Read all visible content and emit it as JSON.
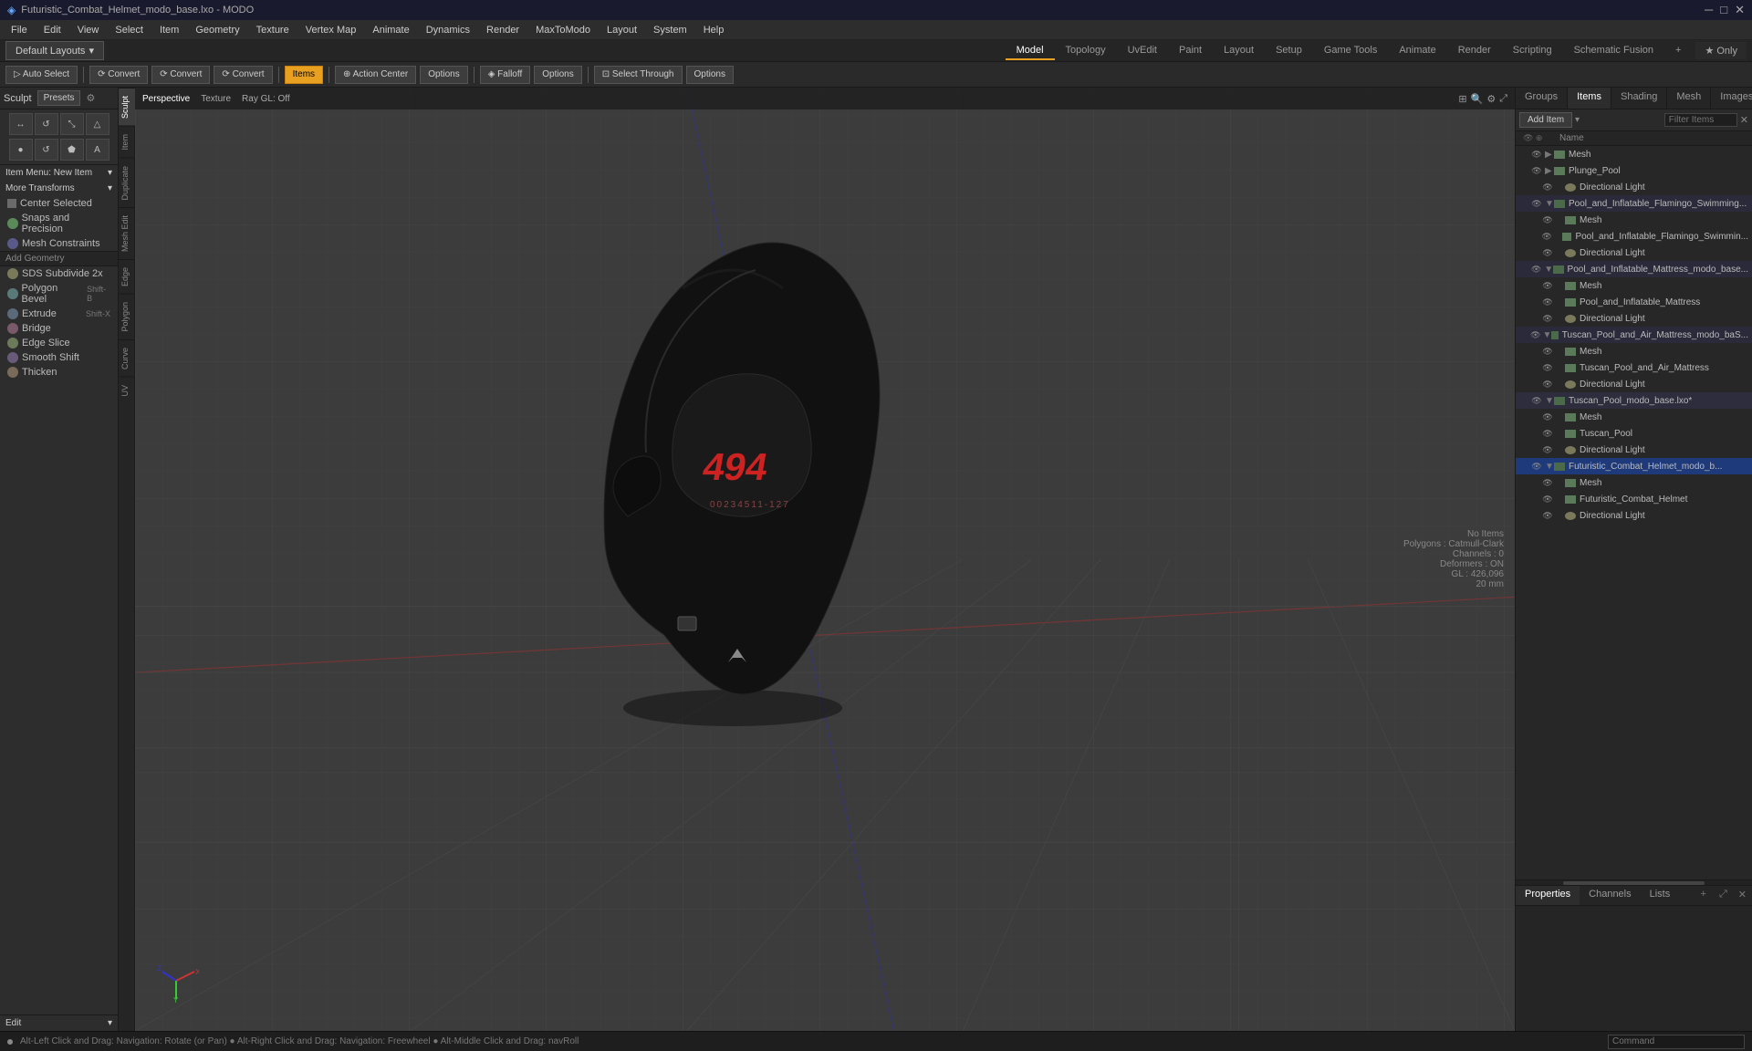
{
  "titlebar": {
    "title": "Futuristic_Combat_Helmet_modo_base.lxo - MODO",
    "controls": [
      "─",
      "□",
      "✕"
    ]
  },
  "menubar": {
    "items": [
      "File",
      "Edit",
      "View",
      "Select",
      "Item",
      "Geometry",
      "Texture",
      "Vertex Map",
      "Animate",
      "Dynamics",
      "Render",
      "MaxToModo",
      "Layout",
      "System",
      "Help"
    ]
  },
  "layoutbar": {
    "default_label": "Default Layouts",
    "tabs": [
      "Model",
      "Topology",
      "UvEdit",
      "Paint",
      "Layout",
      "Setup",
      "Game Tools",
      "Animate",
      "Render",
      "Scripting",
      "Schematic Fusion"
    ],
    "active_tab": "Model",
    "only_label": "★ Only"
  },
  "toolbar": {
    "buttons": [
      {
        "label": "Auto Select",
        "icon": "▷",
        "active": false
      },
      {
        "label": "Convert",
        "icon": "⟳",
        "active": false
      },
      {
        "label": "Convert",
        "icon": "⟳",
        "active": false
      },
      {
        "label": "Convert",
        "icon": "⟳",
        "active": false
      },
      {
        "label": "Items",
        "active": true
      },
      {
        "label": "Action Center",
        "active": false
      },
      {
        "label": "Options",
        "active": false
      },
      {
        "label": "Falloff",
        "active": false
      },
      {
        "label": "Options",
        "active": false
      },
      {
        "label": "Select Through",
        "active": false
      },
      {
        "label": "Options",
        "active": false
      }
    ]
  },
  "left_panel": {
    "sculpt_label": "Sculpt",
    "presets_label": "Presets",
    "icon_rows": [
      [
        "●",
        "◎",
        "⬡",
        "△"
      ],
      [
        "⬤",
        "↺",
        "⬟",
        "A"
      ]
    ],
    "item_menu_label": "Item Menu: New Item",
    "more_transforms_label": "More Transforms",
    "center_selected_label": "Center Selected",
    "snaps_label": "Snaps and Precision",
    "mesh_constraints_label": "Mesh Constraints",
    "add_geometry_label": "Add Geometry",
    "tools": [
      {
        "label": "SDS Subdivide 2x",
        "shortcut": ""
      },
      {
        "label": "Polygon Bevel",
        "shortcut": "Shift-B"
      },
      {
        "label": "Extrude",
        "shortcut": "Shift-X"
      },
      {
        "label": "Bridge",
        "shortcut": ""
      },
      {
        "label": "Edge Slice",
        "shortcut": ""
      },
      {
        "label": "Smooth Shift",
        "shortcut": ""
      },
      {
        "label": "Thicken",
        "shortcut": ""
      }
    ],
    "edit_label": "Edit",
    "strip_tabs": [
      "Sculpt",
      "Item",
      "Duplicate",
      "Mesh Edit",
      "Edge",
      "Polygon",
      "Curve",
      "UV"
    ]
  },
  "viewport": {
    "perspective_label": "Perspective",
    "texture_label": "Texture",
    "ray_gl_label": "Ray GL: Off",
    "no_items_label": "No Items",
    "polygons_label": "Polygons : Catmull-Clark",
    "channels_label": "Channels : 0",
    "deformers_label": "Deformers : ON",
    "gl_label": "GL : 426,096",
    "unit_label": "20 mm",
    "status_text": "Alt-Left Click and Drag: Navigation: Rotate (or Pan)  ●  Alt-Right Click and Drag: Navigation: Freewheel  ●  Alt-Middle Click and Drag: navRoll"
  },
  "right_panel": {
    "tabs": [
      "Groups",
      "Items",
      "Shading",
      "Mesh",
      "Images"
    ],
    "active_tab": "Items",
    "add_item_label": "Add Item",
    "filter_placeholder": "Filter Items",
    "column_header": "Name",
    "items": [
      {
        "level": 1,
        "name": "Mesh",
        "type": "mesh",
        "visible": true,
        "expanded": false
      },
      {
        "level": 1,
        "name": "Plunge_Pool",
        "type": "mesh",
        "visible": true,
        "expanded": false
      },
      {
        "level": 2,
        "name": "Directional Light",
        "type": "light",
        "visible": true,
        "expanded": false
      },
      {
        "level": 1,
        "name": "Pool_and_Inflatable_Flamingo_Swimming...",
        "type": "group",
        "visible": true,
        "expanded": true
      },
      {
        "level": 2,
        "name": "Mesh",
        "type": "mesh",
        "visible": true,
        "expanded": false
      },
      {
        "level": 2,
        "name": "Pool_and_Inflatable_Flamingo_Swimmin...",
        "type": "mesh",
        "visible": true,
        "expanded": false
      },
      {
        "level": 2,
        "name": "Directional Light",
        "type": "light",
        "visible": true,
        "expanded": false
      },
      {
        "level": 1,
        "name": "Pool_and_Inflatable_Mattress_modo_base...",
        "type": "group",
        "visible": true,
        "expanded": true
      },
      {
        "level": 2,
        "name": "Mesh",
        "type": "mesh",
        "visible": true,
        "expanded": false
      },
      {
        "level": 2,
        "name": "Pool_and_Inflatable_Mattress",
        "type": "mesh",
        "visible": true,
        "expanded": false
      },
      {
        "level": 2,
        "name": "Directional Light",
        "type": "light",
        "visible": true,
        "expanded": false
      },
      {
        "level": 1,
        "name": "Tuscan_Pool_and_Air_Mattress_modo_baS...",
        "type": "group",
        "visible": true,
        "expanded": true
      },
      {
        "level": 2,
        "name": "Mesh",
        "type": "mesh",
        "visible": true,
        "expanded": false
      },
      {
        "level": 2,
        "name": "Tuscan_Pool_and_Air_Mattress",
        "type": "mesh",
        "visible": true,
        "expanded": false
      },
      {
        "level": 2,
        "name": "Directional Light",
        "type": "light",
        "visible": true,
        "expanded": false
      },
      {
        "level": 1,
        "name": "Tuscan_Pool_modo_base.lxo*",
        "type": "group",
        "visible": true,
        "expanded": true,
        "active": true
      },
      {
        "level": 2,
        "name": "Mesh",
        "type": "mesh",
        "visible": true,
        "expanded": false
      },
      {
        "level": 2,
        "name": "Tuscan_Pool",
        "type": "mesh",
        "visible": true,
        "expanded": false
      },
      {
        "level": 2,
        "name": "Directional Light",
        "type": "light",
        "visible": true,
        "expanded": false
      },
      {
        "level": 1,
        "name": "Futuristic_Combat_Helmet_modo_b...",
        "type": "group",
        "visible": true,
        "expanded": true,
        "selected": true
      },
      {
        "level": 2,
        "name": "Mesh",
        "type": "mesh",
        "visible": true,
        "expanded": false
      },
      {
        "level": 2,
        "name": "Futuristic_Combat_Helmet",
        "type": "mesh",
        "visible": true,
        "expanded": false
      },
      {
        "level": 2,
        "name": "Directional Light",
        "type": "light",
        "visible": true,
        "expanded": false
      }
    ],
    "bottom_tabs": [
      "Properties",
      "Channels",
      "Lists"
    ],
    "active_bottom_tab": "Properties"
  },
  "bottom_status": {
    "status_text": "Alt-Left Click and Drag: Navigation: Rotate (or Pan)  ●  Alt-Right Click and Drag: Navigation: Freewheel  ●  Alt-Middle Click and Drag: navRoll",
    "command_placeholder": "Command"
  }
}
